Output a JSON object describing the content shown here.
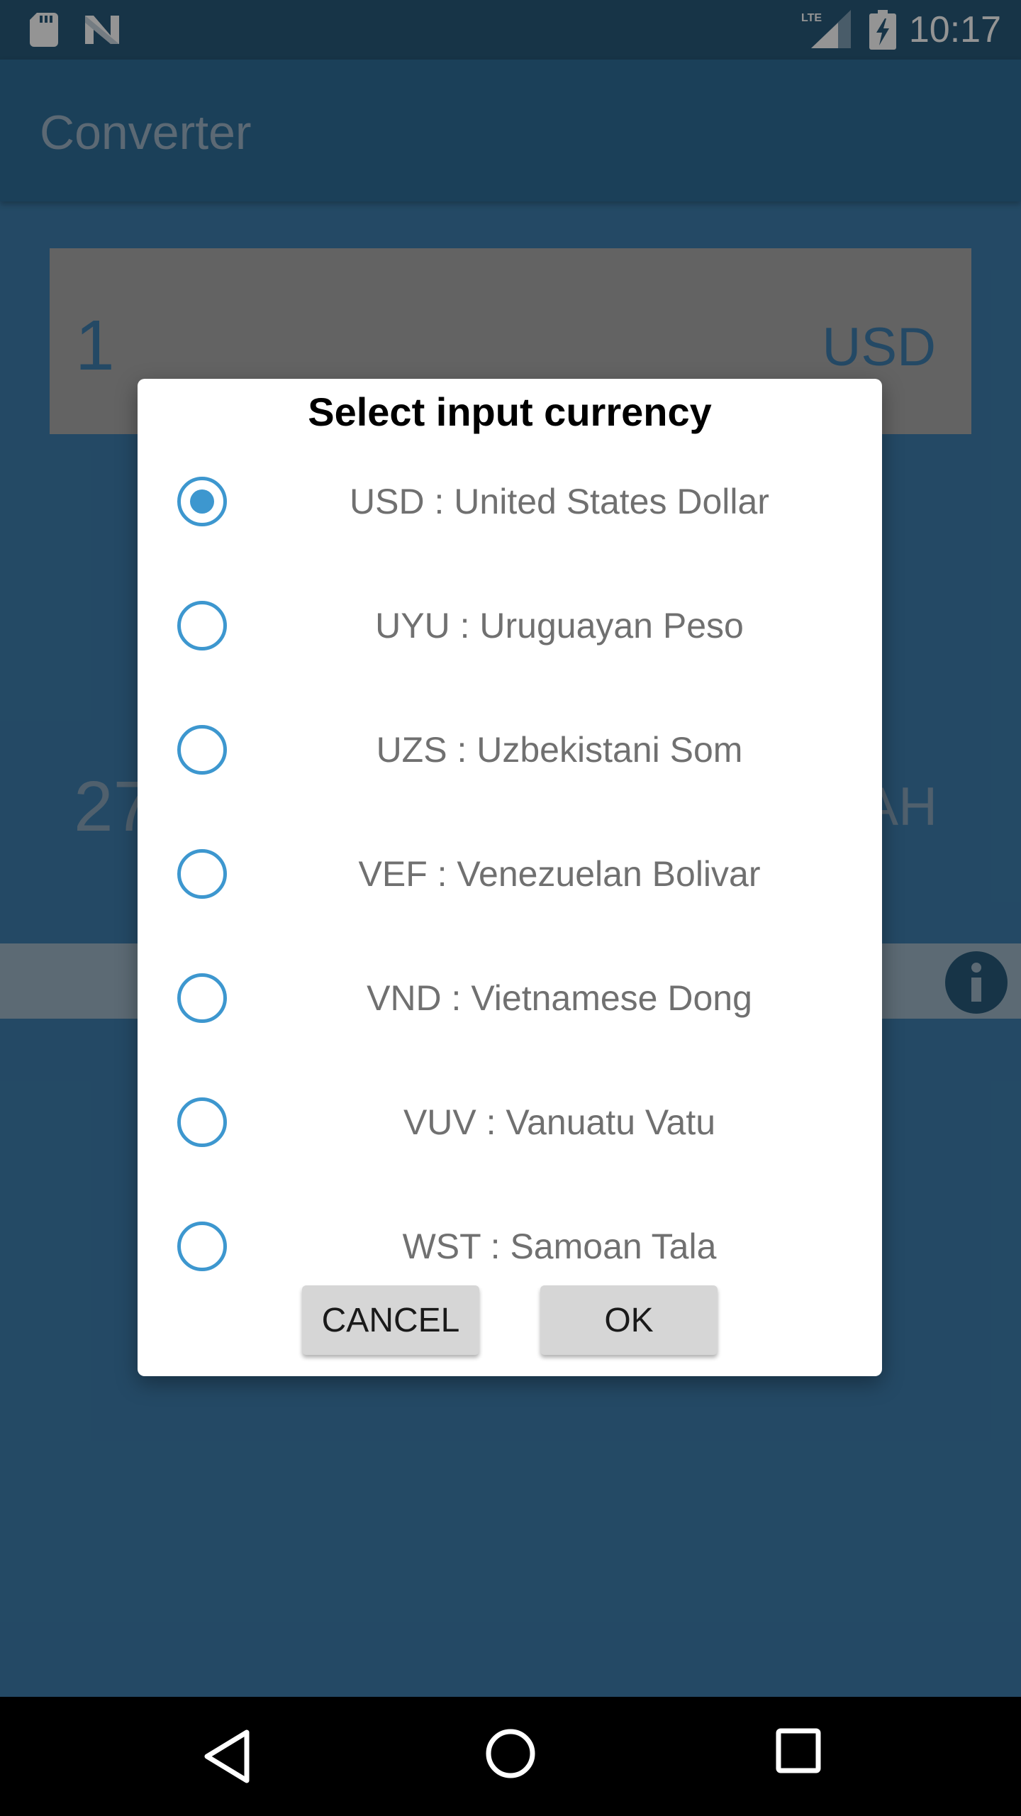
{
  "status_bar": {
    "time": "10:17",
    "icons": [
      "sd-card-icon",
      "n-logo-icon",
      "lte-signal-icon",
      "battery-charging-icon"
    ]
  },
  "app_bar": {
    "title": "Converter"
  },
  "input": {
    "amount": "1",
    "currency": "USD"
  },
  "output": {
    "amount": "27",
    "currency": "AH"
  },
  "dialog": {
    "title": "Select input currency",
    "options": [
      {
        "label": "USD : United States Dollar",
        "selected": true
      },
      {
        "label": "UYU : Uruguayan Peso",
        "selected": false
      },
      {
        "label": "UZS : Uzbekistani Som",
        "selected": false
      },
      {
        "label": "VEF : Venezuelan Bolivar",
        "selected": false
      },
      {
        "label": "VND : Vietnamese Dong",
        "selected": false
      },
      {
        "label": "VUV : Vanuatu Vatu",
        "selected": false
      },
      {
        "label": "WST : Samoan Tala",
        "selected": false
      }
    ],
    "cancel_label": "CANCEL",
    "ok_label": "OK"
  },
  "colors": {
    "accent": "#3d97cf",
    "primary": "#3e7fae",
    "primary_dark": "#285a7a"
  }
}
